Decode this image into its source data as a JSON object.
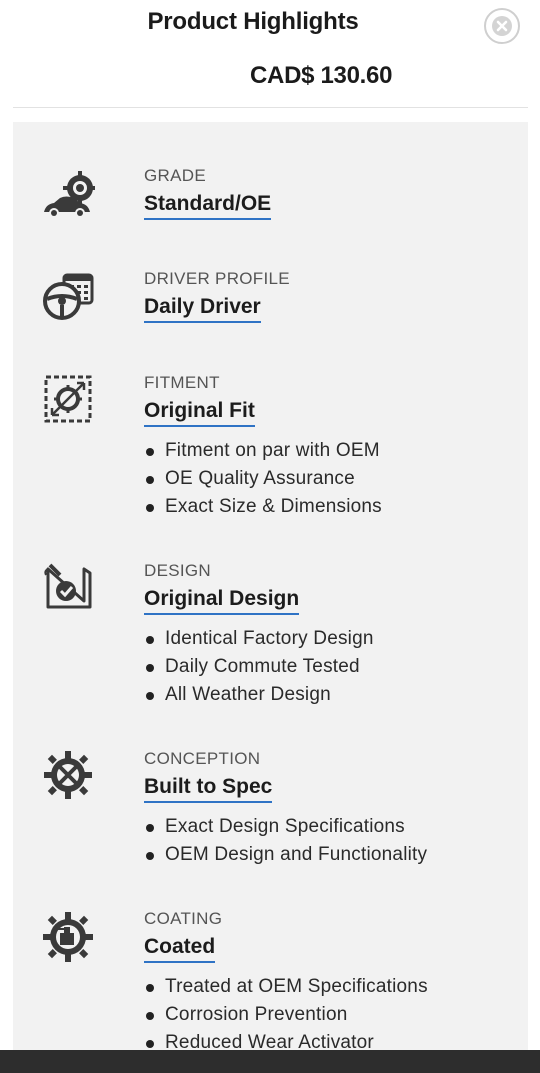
{
  "header": {
    "title": "Product Highlights",
    "price": "CAD$ 130.60",
    "close_icon": "close-icon"
  },
  "colors": {
    "accent_underline": "#2f73c5",
    "panel_background": "#f2f2f2",
    "icon_color": "#3a3a3a"
  },
  "highlights": [
    {
      "icon": "car-gear-icon",
      "label": "GRADE",
      "value": "Standard/OE",
      "bullets": []
    },
    {
      "icon": "steering-wheel-calendar-icon",
      "label": "DRIVER PROFILE",
      "value": "Daily Driver",
      "bullets": []
    },
    {
      "icon": "fitment-frame-icon",
      "label": "FITMENT",
      "value": "Original Fit",
      "bullets": [
        "Fitment on par with OEM",
        "OE Quality Assurance",
        "Exact Size & Dimensions"
      ]
    },
    {
      "icon": "blueprint-check-icon",
      "label": "DESIGN",
      "value": "Original Design",
      "bullets": [
        "Identical Factory Design",
        "Daily Commute Tested",
        "All Weather Design"
      ]
    },
    {
      "icon": "gear-tools-icon",
      "label": "CONCEPTION",
      "value": "Built to Spec",
      "bullets": [
        "Exact Design Specifications",
        "OEM Design and Functionality"
      ]
    },
    {
      "icon": "gear-spray-icon",
      "label": "COATING",
      "value": "Coated",
      "bullets": [
        "Treated at OEM Specifications",
        "Corrosion Prevention",
        "Reduced Wear Activator"
      ]
    }
  ]
}
